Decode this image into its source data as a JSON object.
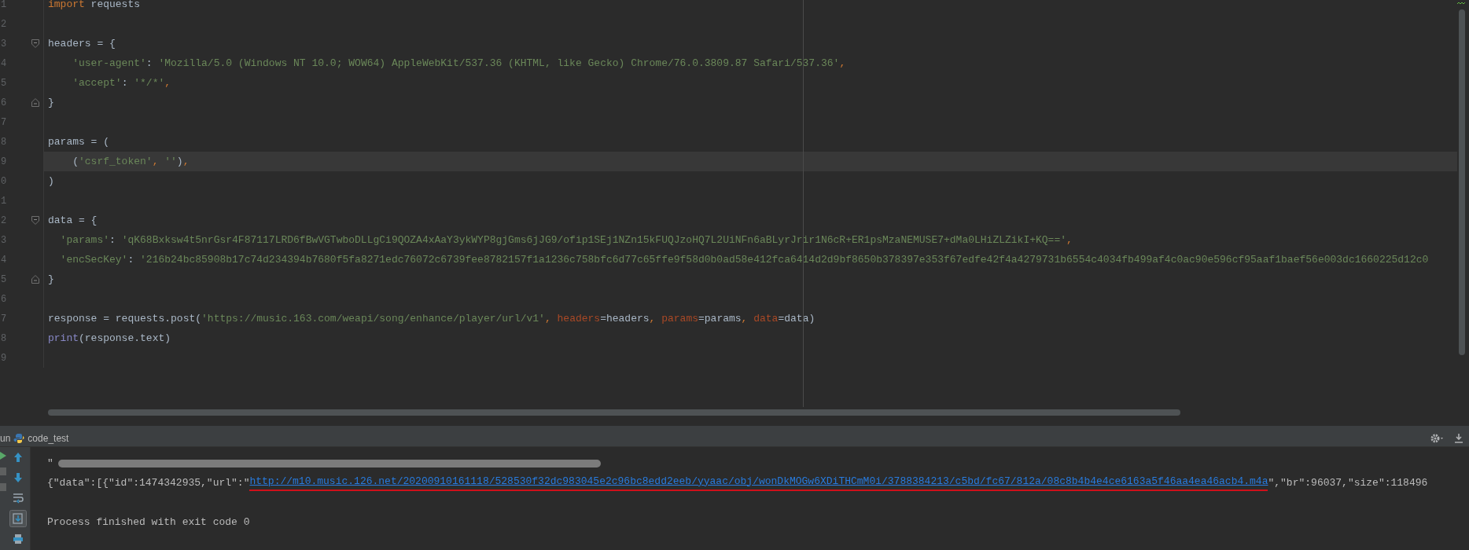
{
  "editor": {
    "lines": [
      {
        "number": "1",
        "current": false,
        "kind": "code",
        "tokens": [
          {
            "kind": "keyword",
            "text": "import"
          },
          {
            "kind": "plain",
            "text": " requests"
          }
        ]
      },
      {
        "number": "2",
        "current": false,
        "kind": "code"
      },
      {
        "number": "3",
        "current": false,
        "kind": "fold-start",
        "tokens": [
          {
            "kind": "plain",
            "text": "headers = {"
          }
        ]
      },
      {
        "number": "4",
        "current": false,
        "kind": "code",
        "tokens": [
          {
            "kind": "string",
            "text": "    'user-agent'"
          },
          {
            "kind": "plain",
            "text": ": "
          },
          {
            "kind": "string",
            "text": "'Mozilla/5.0 (Windows NT 10.0; WOW64) AppleWebKit/537.36 (KHTML, like Gecko) Chrome/76.0.3809.87 Safari/537.36'"
          },
          {
            "kind": "keyword",
            "text": ","
          }
        ]
      },
      {
        "number": "5",
        "current": false,
        "kind": "code",
        "tokens": [
          {
            "kind": "string",
            "text": "    'accept'"
          },
          {
            "kind": "plain",
            "text": ": "
          },
          {
            "kind": "string",
            "text": "'*/*'"
          },
          {
            "kind": "keyword",
            "text": ","
          }
        ]
      },
      {
        "number": "6",
        "current": false,
        "kind": "fold-end",
        "tokens": [
          {
            "kind": "plain",
            "text": "}"
          }
        ]
      },
      {
        "number": "7",
        "current": false,
        "kind": "code"
      },
      {
        "number": "8",
        "current": false,
        "kind": "code",
        "tokens": [
          {
            "kind": "plain",
            "text": "params = ("
          }
        ]
      },
      {
        "number": "9",
        "current": true,
        "kind": "code",
        "tokens": [
          {
            "kind": "plain",
            "text": "    ("
          },
          {
            "kind": "string",
            "text": "'csrf_token'"
          },
          {
            "kind": "keyword",
            "text": ", "
          },
          {
            "kind": "string",
            "text": "''"
          },
          {
            "kind": "plain",
            "text": ")"
          },
          {
            "kind": "keyword",
            "text": ","
          }
        ]
      },
      {
        "number": "0",
        "current": false,
        "kind": "code",
        "tokens": [
          {
            "kind": "plain",
            "text": ")"
          }
        ]
      },
      {
        "number": "1",
        "current": false,
        "kind": "code"
      },
      {
        "number": "2",
        "current": false,
        "kind": "fold-start",
        "tokens": [
          {
            "kind": "plain",
            "text": "data = {"
          }
        ]
      },
      {
        "number": "3",
        "current": false,
        "kind": "code",
        "tokens": [
          {
            "kind": "string",
            "text": "  'params'"
          },
          {
            "kind": "plain",
            "text": ": "
          },
          {
            "kind": "string",
            "text": "'qK68Bxksw4t5nrGsr4F87117LRD6fBwVGTwboDLLgCi9QOZA4xAaY3ykWYP8gjGms6jJG9/ofip1SEj1NZn15kFUQJzoHQ7L2UiNFn6aBLyrJrir1N6cR+ER1psMzaNEMUSE7+dMa0LHiZLZikI+KQ=='"
          },
          {
            "kind": "keyword",
            "text": ","
          }
        ]
      },
      {
        "number": "4",
        "current": false,
        "kind": "code",
        "tokens": [
          {
            "kind": "string",
            "text": "  'encSecKey'"
          },
          {
            "kind": "plain",
            "text": ": "
          },
          {
            "kind": "string",
            "text": "'216b24bc85908b17c74d234394b7680f5fa8271edc76072c6739fee8782157f1a1236c758bfc6d77c65ffe9f58d0b0ad58e412fca6414d2d9bf8650b378397e353f67edfe42f4a4279731b6554c4034fb499af4c0ac90e596cf95aaf1baef56e003dc1660225d12c0"
          }
        ]
      },
      {
        "number": "5",
        "current": false,
        "kind": "fold-end",
        "tokens": [
          {
            "kind": "plain",
            "text": "}"
          }
        ]
      },
      {
        "number": "6",
        "current": false,
        "kind": "code"
      },
      {
        "number": "7",
        "current": false,
        "kind": "code",
        "tokens": [
          {
            "kind": "plain",
            "text": "response = requests.post("
          },
          {
            "kind": "string",
            "text": "'https://music.163.com/weapi/song/enhance/player/url/v1'"
          },
          {
            "kind": "keyword",
            "text": ", "
          },
          {
            "kind": "kwarg",
            "text": "headers"
          },
          {
            "kind": "plain",
            "text": "=headers"
          },
          {
            "kind": "keyword",
            "text": ", "
          },
          {
            "kind": "kwarg",
            "text": "params"
          },
          {
            "kind": "plain",
            "text": "=params"
          },
          {
            "kind": "keyword",
            "text": ", "
          },
          {
            "kind": "kwarg",
            "text": "data"
          },
          {
            "kind": "plain",
            "text": "=data)"
          }
        ]
      },
      {
        "number": "8",
        "current": false,
        "kind": "code",
        "tokens": [
          {
            "kind": "builtin",
            "text": "print"
          },
          {
            "kind": "plain",
            "text": "(response.text)"
          }
        ]
      },
      {
        "number": "9",
        "current": false,
        "kind": "code"
      }
    ]
  },
  "run_panel": {
    "title": "un",
    "config": "code_test",
    "tools": [
      {
        "kind": "up",
        "on": false
      },
      {
        "kind": "down",
        "on": false
      },
      {
        "kind": "wrap",
        "on": false
      },
      {
        "kind": "scroll-end",
        "on": true
      },
      {
        "kind": "print",
        "on": false
      }
    ],
    "output": [
      {
        "kind": "redacted",
        "text": "\""
      },
      {
        "kind": "result",
        "before": "{\"data\":[{\"id\":1474342935,\"url\":\"",
        "link": "http://m10.music.126.net/20200910161118/528530f32dc983045e2c96bc8edd2eeb/yyaac/obj/wonDkMOGw6XDiTHCmM0i/3788384213/c5bd/fc67/812a/08c8b4b4e4ce6163a5f46aa4ea46acb4.m4a",
        "after": "\",\"br\":96037,\"size\":118496"
      },
      {
        "kind": "blank"
      },
      {
        "kind": "plain",
        "text": "Process finished with exit code 0"
      }
    ]
  }
}
